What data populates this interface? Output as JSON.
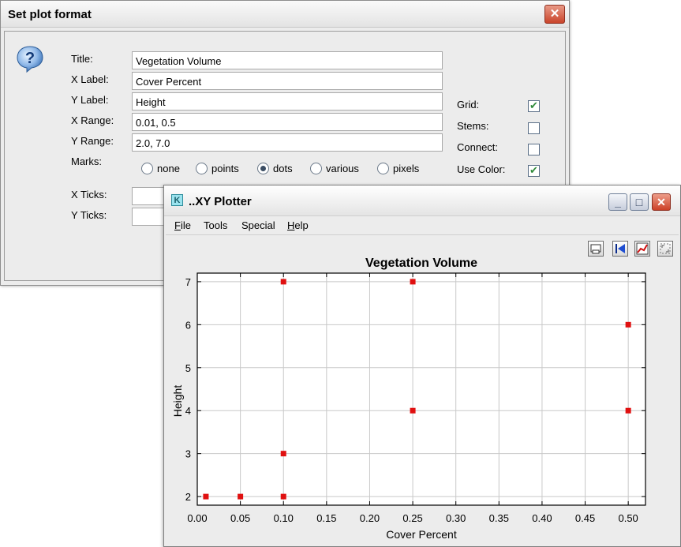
{
  "dialog": {
    "title": "Set plot format",
    "close_symbol": "✕",
    "icon": "question-icon",
    "fields": [
      {
        "label": "Title:",
        "value": "Vegetation Volume"
      },
      {
        "label": "X Label:",
        "value": "Cover Percent"
      },
      {
        "label": "Y Label:",
        "value": "Height"
      },
      {
        "label": "X Range:",
        "value": "0.01, 0.5"
      },
      {
        "label": "Y Range:",
        "value": "2.0, 7.0"
      }
    ],
    "marks_label": "Marks:",
    "marks_options": [
      "none",
      "points",
      "dots",
      "various",
      "pixels"
    ],
    "marks_selected": "dots",
    "xticks_label": "X Ticks:",
    "xticks_value": "",
    "yticks_label": "Y Ticks:",
    "yticks_value": "",
    "options": [
      {
        "label": "Grid:",
        "checked": true
      },
      {
        "label": "Stems:",
        "checked": false
      },
      {
        "label": "Connect:",
        "checked": false
      },
      {
        "label": "Use Color:",
        "checked": true
      }
    ]
  },
  "plotter": {
    "app_icon_letter": "K",
    "title": "..XY Plotter",
    "minimize_symbol": "_",
    "maximize_symbol": "□",
    "close_symbol": "✕",
    "menu": [
      "File",
      "Tools",
      "Special",
      "Help"
    ],
    "menu_mnemonics": [
      "F",
      "",
      "",
      "H"
    ],
    "toolbar_icons": [
      "print-icon",
      "back-icon",
      "graph-icon",
      "fit-icon"
    ]
  },
  "chart_data": {
    "type": "scatter",
    "title": "Vegetation Volume",
    "xlabel": "Cover Percent",
    "ylabel": "Height",
    "xlim": [
      0.0,
      0.52
    ],
    "ylim": [
      1.8,
      7.2
    ],
    "xticks": [
      0.0,
      0.05,
      0.1,
      0.15,
      0.2,
      0.25,
      0.3,
      0.35,
      0.4,
      0.45,
      0.5
    ],
    "xtick_labels": [
      "0.00",
      "0.05",
      "0.10",
      "0.15",
      "0.20",
      "0.25",
      "0.30",
      "0.35",
      "0.40",
      "0.45",
      "0.50"
    ],
    "yticks": [
      2,
      3,
      4,
      5,
      6,
      7
    ],
    "ytick_labels": [
      "2",
      "3",
      "4",
      "5",
      "6",
      "7"
    ],
    "grid": true,
    "marker_color": "#e01010",
    "points": [
      {
        "x": 0.01,
        "y": 2
      },
      {
        "x": 0.05,
        "y": 2
      },
      {
        "x": 0.1,
        "y": 2
      },
      {
        "x": 0.1,
        "y": 3
      },
      {
        "x": 0.1,
        "y": 7
      },
      {
        "x": 0.25,
        "y": 4
      },
      {
        "x": 0.25,
        "y": 7
      },
      {
        "x": 0.5,
        "y": 4
      },
      {
        "x": 0.5,
        "y": 6
      }
    ]
  }
}
